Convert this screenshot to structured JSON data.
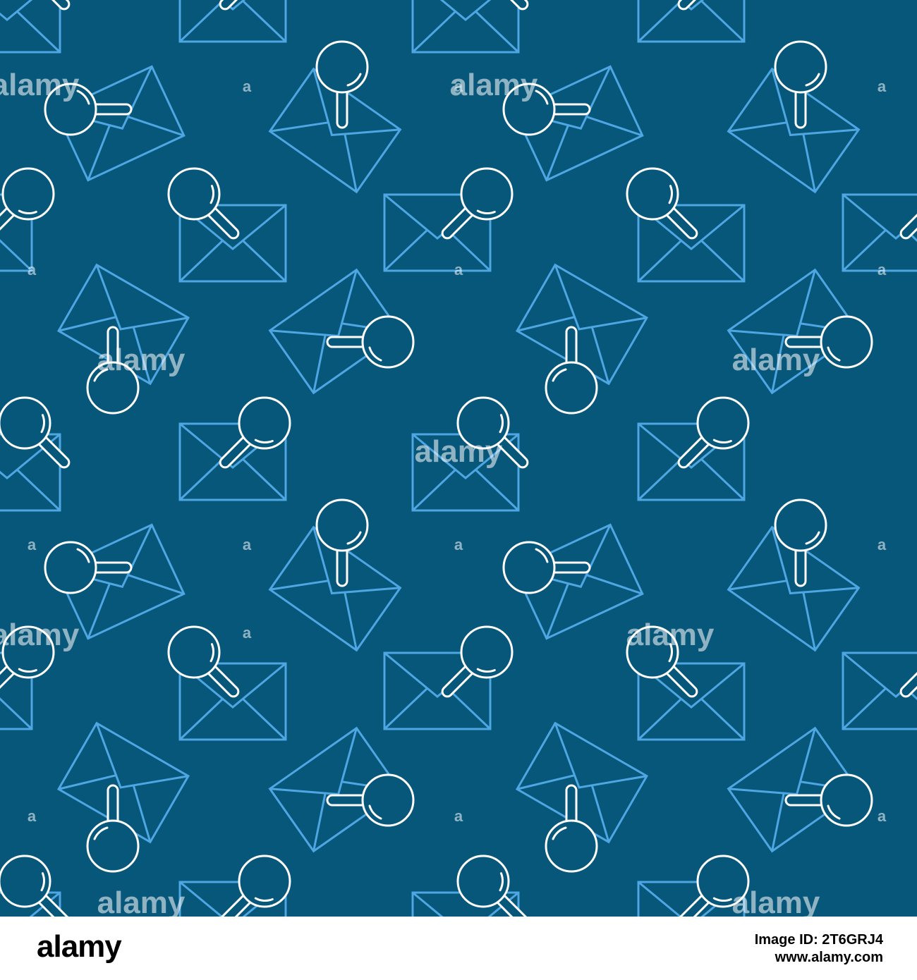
{
  "colors": {
    "background": "#07577a",
    "envelope": "#4ea6e2",
    "magnifier": "#ffffff",
    "watermark": "#ffffff",
    "footer_bg": "#ffffff",
    "footer_text": "#000000"
  },
  "pattern": {
    "icon_names": [
      "envelope-icon",
      "magnifier-icon"
    ],
    "watermark_text": "alamy",
    "watermark_small": "a"
  },
  "footer": {
    "brand": "alamy",
    "image_id": "Image ID: 2T6GRJ4",
    "url": "www.alamy.com"
  }
}
